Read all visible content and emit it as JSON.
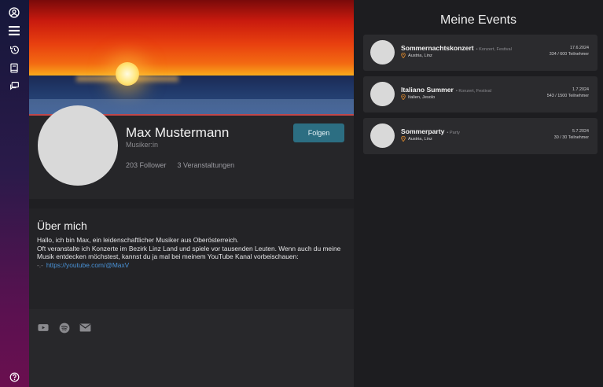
{
  "sidebar": {
    "icons": [
      "account-icon",
      "menu-icon",
      "history-icon",
      "book-icon",
      "chat-icon",
      "help-icon"
    ]
  },
  "profile": {
    "name": "Max Mustermann",
    "role": "Musiker:in",
    "followers": "203 Follower",
    "events_count": "3 Veranstaltungen",
    "follow_label": "Folgen"
  },
  "about": {
    "title": "Über mich",
    "lines": [
      "Hallo, ich bin Max, ein leidenschaftlicher Musiker aus Oberösterreich.",
      "Oft veranstalte ich Konzerte im Bezirk Linz Land und spiele vor tausenden Leuten. Wenn auch du meine Musik entdecken möchstest, kannst du ja mal bei meinem YouTube Kanal vorbeischauen:"
    ],
    "link_prefix": "-.-",
    "link": "https://youtube.com/@MaxV"
  },
  "socials": [
    "youtube-icon",
    "spotify-icon",
    "mail-icon"
  ],
  "events": {
    "title": "Meine Events",
    "items": [
      {
        "name": "Sommernachtskonzert",
        "category": "• Konzert, Festival",
        "location": "Austria, Linz",
        "date": "17.6.2024",
        "participants": "334 / 600 Teilnehmer"
      },
      {
        "name": "Italiano Summer",
        "category": "• Konzert, Festival",
        "location": "Italien, Jesolo",
        "date": "1.7.2024",
        "participants": "543 / 1500 Teilnehmer"
      },
      {
        "name": "Sommerparty",
        "category": "• Party",
        "location": "Austria, Linz",
        "date": "5.7.2024",
        "participants": "30 / 30 Teilnehmer"
      }
    ]
  },
  "colors": {
    "follow_button": "#2c6e82",
    "link": "#4a93d8",
    "location_pin": "#e08a2c"
  }
}
